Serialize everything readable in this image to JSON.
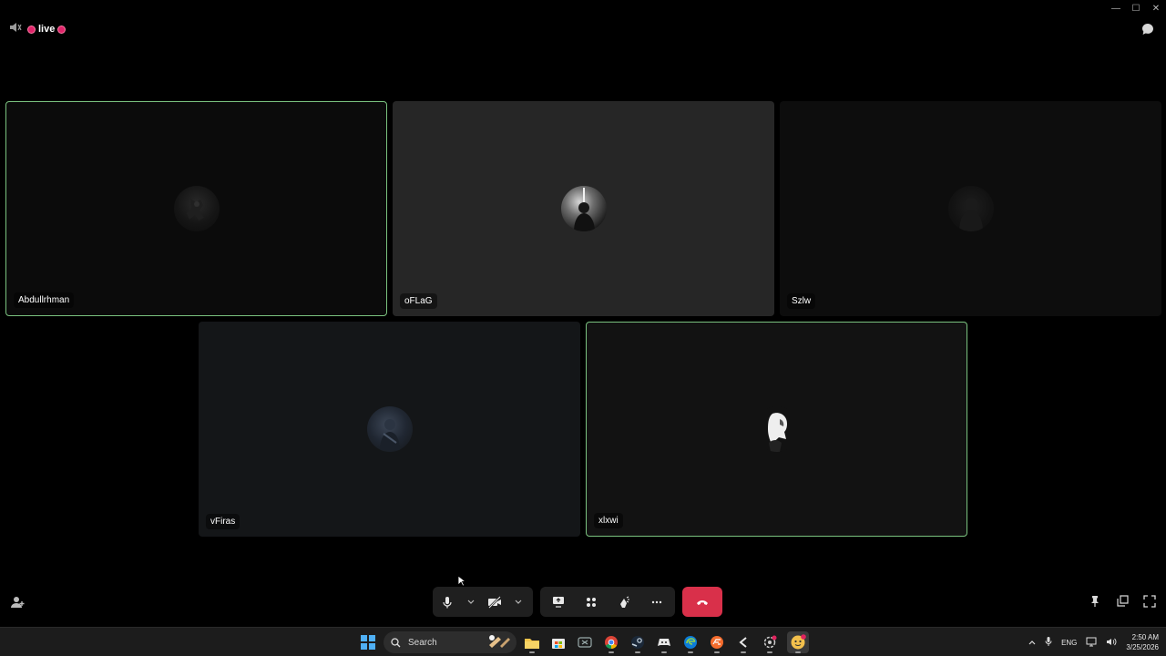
{
  "window": {
    "minimize_label": "—",
    "maximize_label": "☐",
    "close_label": "✕"
  },
  "topbar": {
    "live_label": "live"
  },
  "tiles": [
    {
      "name": "Abdullrhman",
      "speaking": true
    },
    {
      "name": "oFLaG",
      "speaking": false
    },
    {
      "name": "Szlw",
      "speaking": false
    },
    {
      "name": "vFiras",
      "speaking": false
    },
    {
      "name": "xlxwi",
      "speaking": true
    }
  ],
  "controls": {
    "microphone": "microphone-icon",
    "camera": "camera-off-icon",
    "screen_share": "screen-share-icon",
    "activities": "activities-icon",
    "soundboard": "soundboard-icon",
    "more": "more-icon",
    "leave": "hang-up-icon"
  },
  "taskbar": {
    "search_placeholder": "Search",
    "apps": [
      "file-explorer-icon",
      "microsoft-store-icon",
      "xbox-icon",
      "chrome-icon",
      "steam-icon",
      "game-icon",
      "edge-icon",
      "ea-icon",
      "app-icon",
      "settings-icon",
      "discord-icon"
    ],
    "tray": {
      "language": "ENG",
      "time": "2:50 AM",
      "date": "3/25/2026"
    }
  },
  "colors": {
    "speaking_border": "#7ac27f",
    "live_dot": "#e0246a",
    "leave_button": "#d9304a",
    "start_icon": "#4fb0f5"
  }
}
